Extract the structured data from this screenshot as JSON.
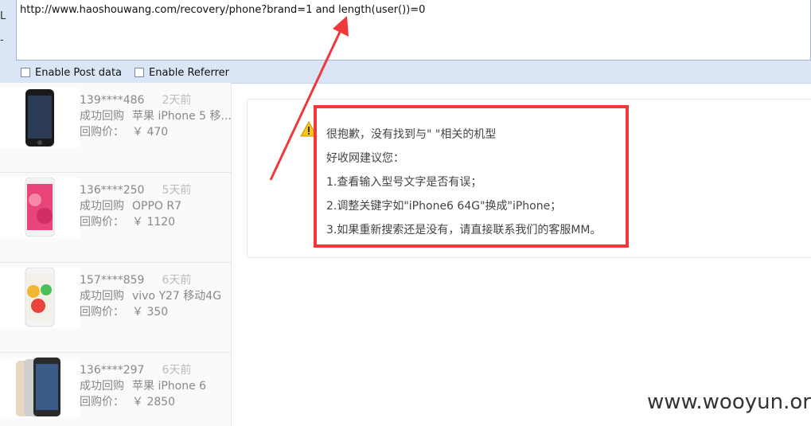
{
  "toolbar": {
    "side_letters": [
      "L",
      "-"
    ],
    "url": "http://www.haoshouwang.com/recovery/phone?brand=1 and length(user())=0",
    "enable_post": "Enable Post data",
    "enable_referrer": "Enable Referrer"
  },
  "orders": [
    {
      "phone": "139****486",
      "time": "2天前",
      "status": "成功回购",
      "model": "苹果 iPhone 5 移...",
      "price_label": "回购价：",
      "price": "￥ 470"
    },
    {
      "phone": "136****250",
      "time": "5天前",
      "status": "成功回购",
      "model": "OPPO R7",
      "price_label": "回购价：",
      "price": "￥ 1120"
    },
    {
      "phone": "157****859",
      "time": "6天前",
      "status": "成功回购",
      "model": "vivo Y27 移动4G",
      "price_label": "回购价：",
      "price": "￥ 350"
    },
    {
      "phone": "136****297",
      "time": "6天前",
      "status": "成功回购",
      "model": "苹果 iPhone 6",
      "price_label": "回购价：",
      "price": "￥ 2850"
    }
  ],
  "message": {
    "line1": "很抱歉，没有找到与\" \"相关的机型",
    "line2": "好收网建议您：",
    "line3": "1.查看输入型号文字是否有误；",
    "line4": "2.调整关键字如\"iPhone6 64G\"换成\"iPhone；",
    "line5": "3.如果重新搜索还是没有，请直接联系我们的客服MM。"
  },
  "watermark": "www.wooyun.org",
  "colors": {
    "highlight": "#f0383b",
    "toolbar_bg": "#dae6f5"
  }
}
